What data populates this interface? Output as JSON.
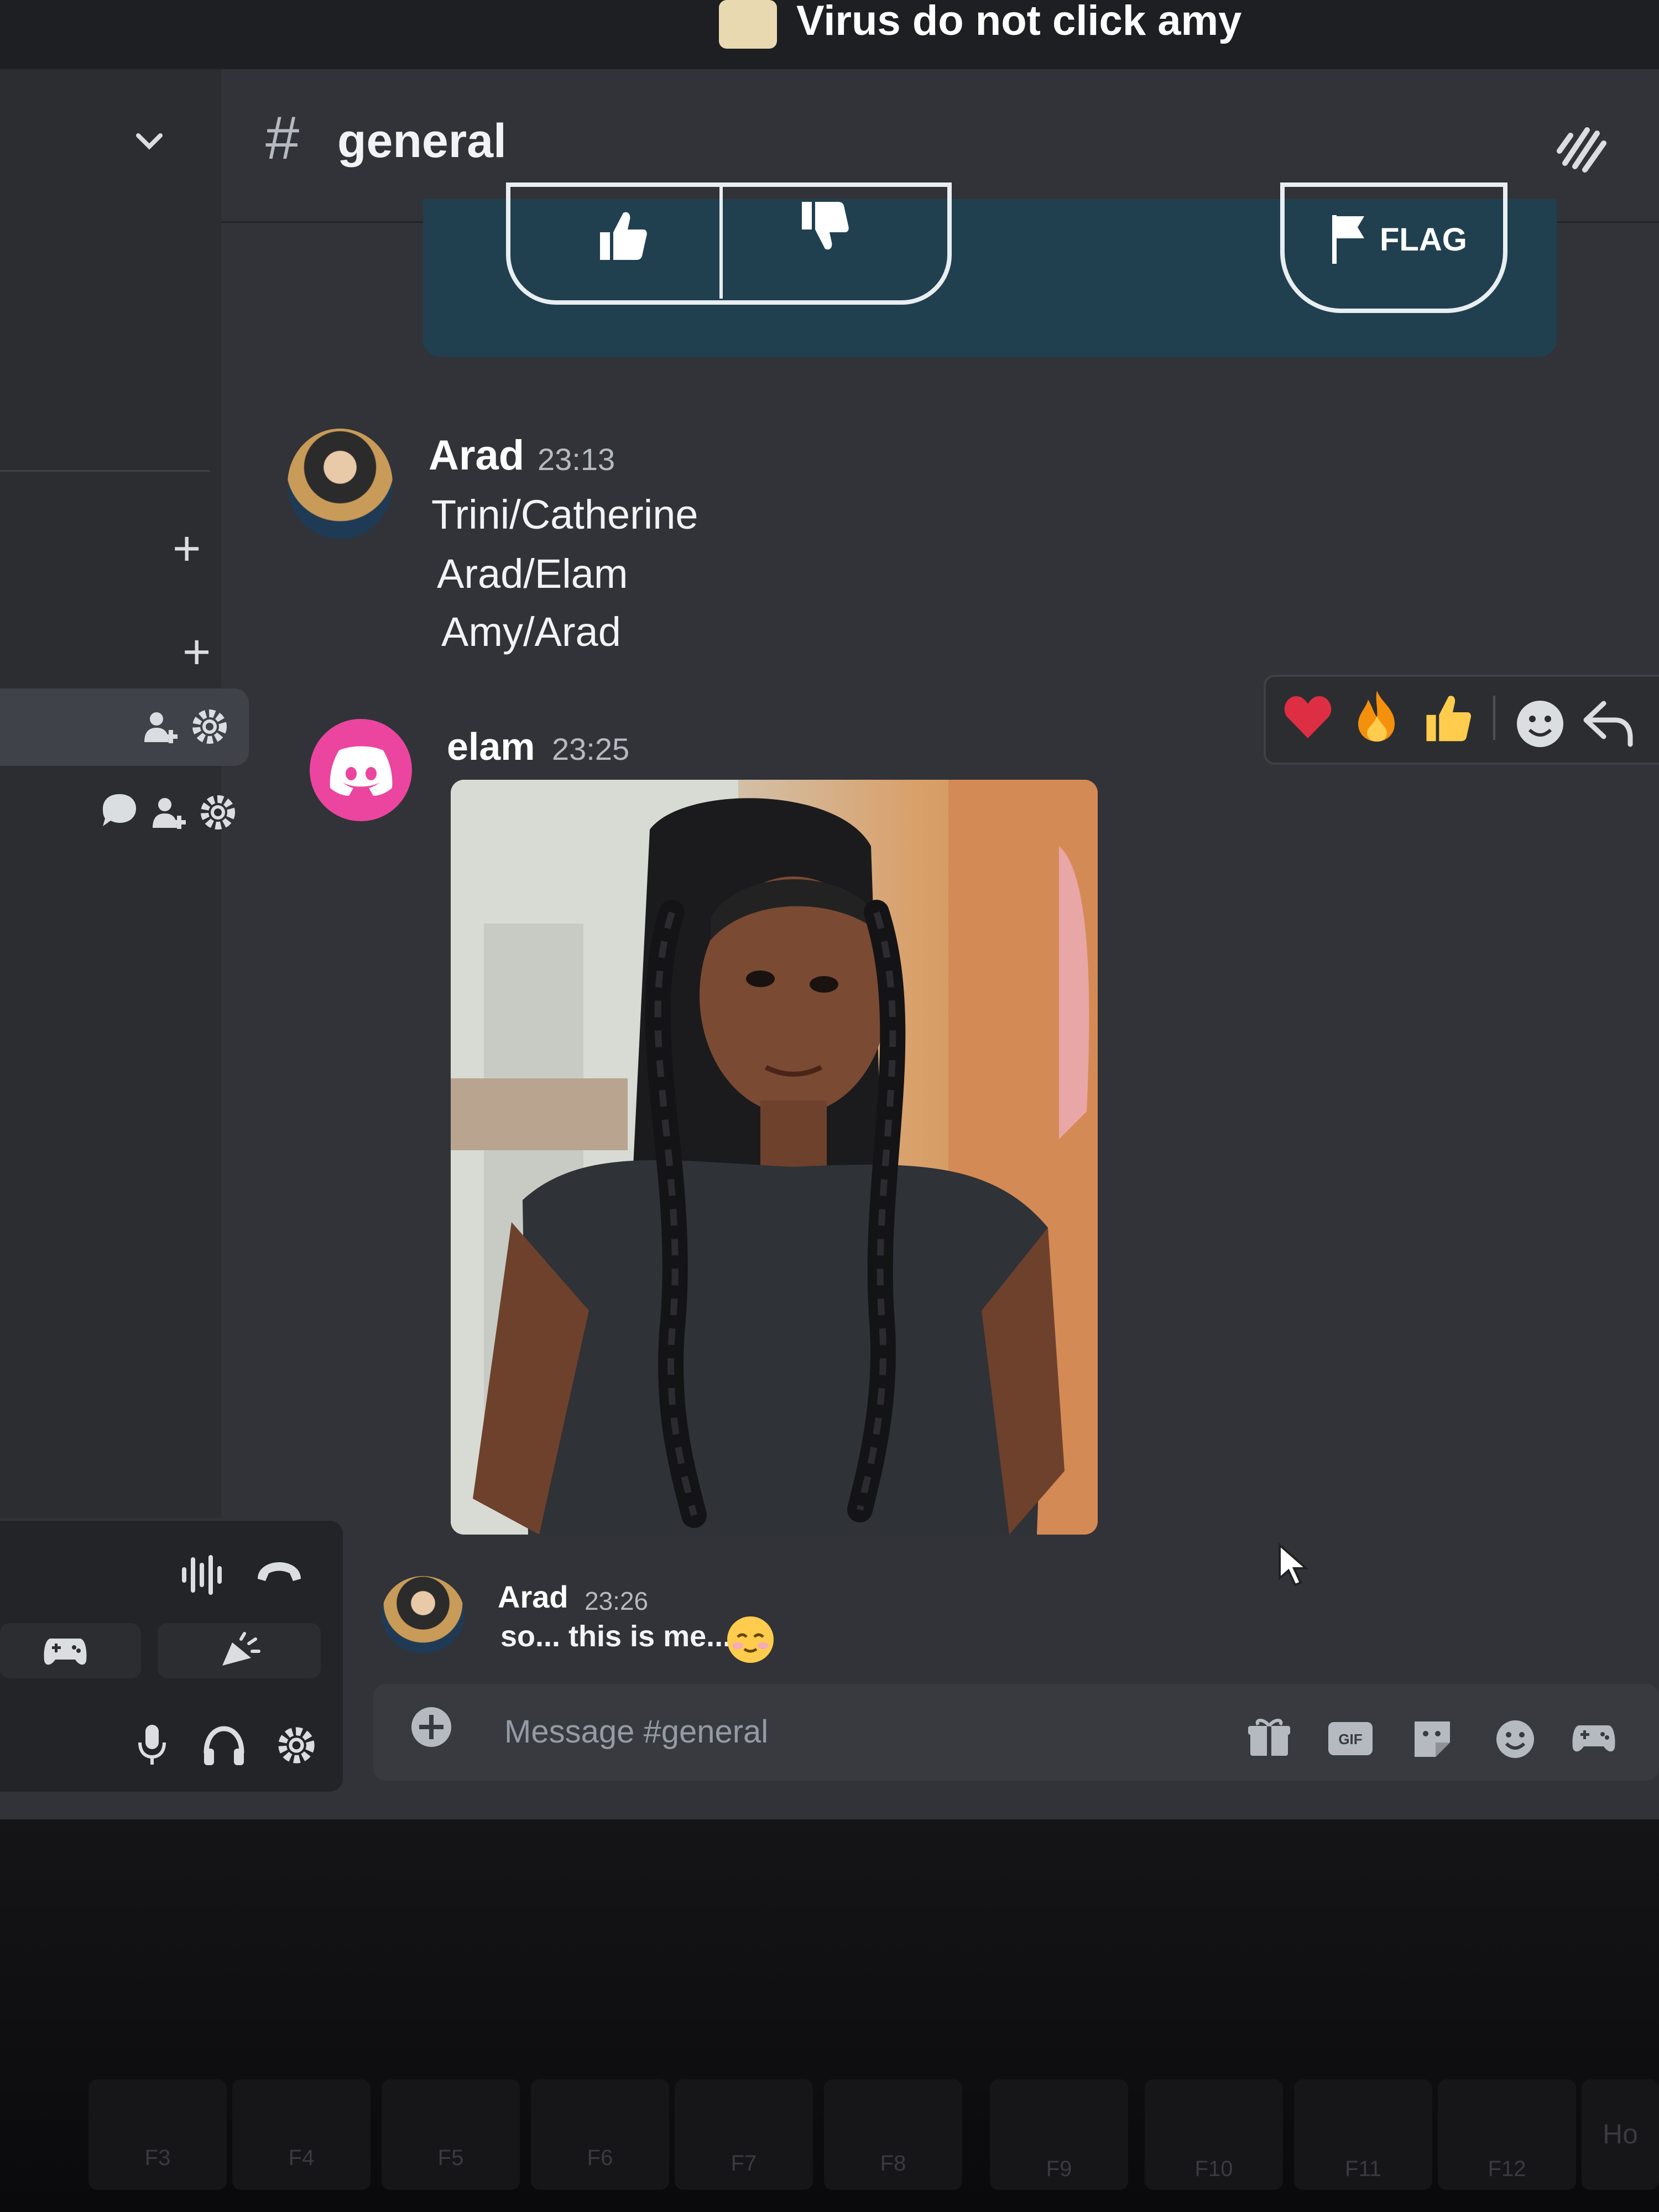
{
  "window": {
    "server_title": "Virus do not click amy"
  },
  "channel": {
    "hash": "#",
    "name": "general"
  },
  "embed": {
    "flag_label": "FLAG"
  },
  "messages": [
    {
      "user": "Arad",
      "time": "23:13",
      "lines": [
        "Trini/Catherine",
        "Arad/Elam",
        "Amy/Arad"
      ]
    },
    {
      "user": "elam",
      "time": "23:25",
      "attachment": "image"
    },
    {
      "user": "Arad",
      "time": "23:26",
      "text": "so... this is me..."
    }
  ],
  "reactions": [
    "heart-emoji",
    "fire-emoji",
    "thumbs-up-emoji",
    "add-reaction-icon",
    "reply-icon"
  ],
  "composer": {
    "placeholder": "Message #general"
  },
  "keyboard": {
    "fkeys": [
      "F3",
      "F4",
      "F5",
      "F6",
      "F7",
      "F8",
      "F9",
      "F10",
      "F11",
      "F12"
    ],
    "partial_key": "Ho"
  },
  "colors": {
    "background": "#313338",
    "sidebar": "#2b2d31",
    "composer": "#383a40",
    "accent_pink": "#eb459f",
    "embed": "#20404f"
  }
}
